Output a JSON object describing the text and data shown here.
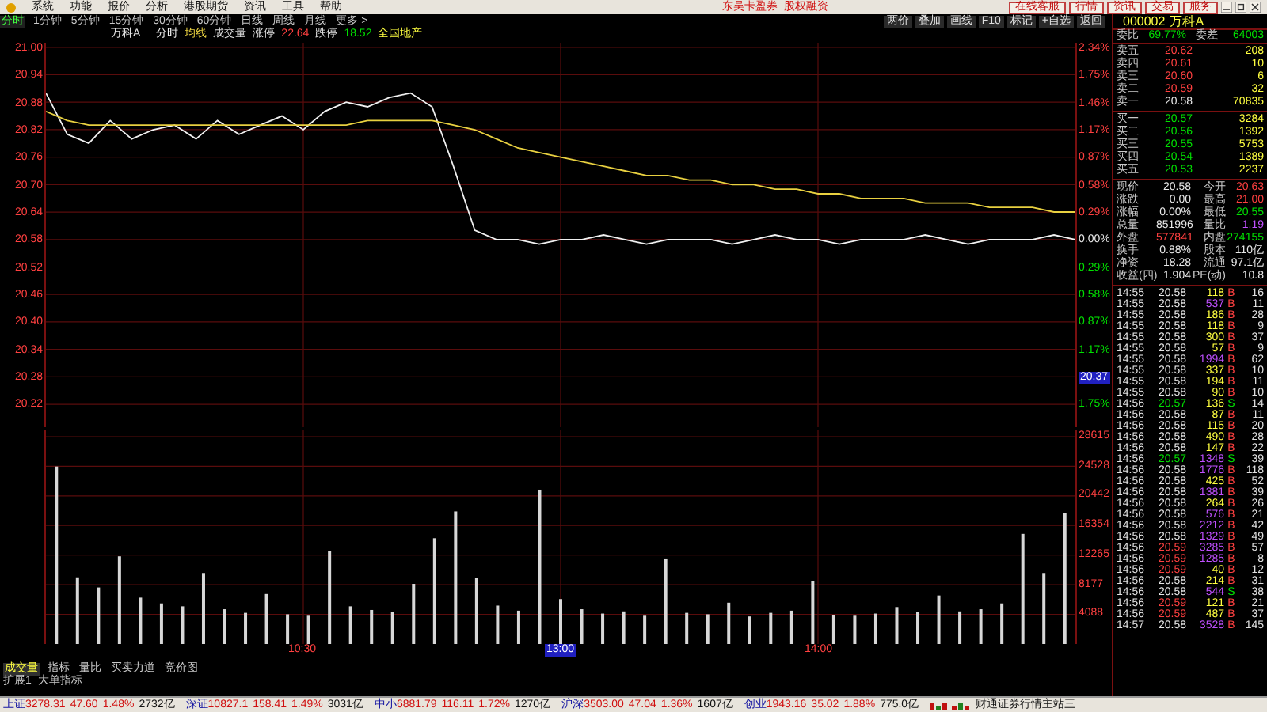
{
  "menu_bar": {
    "items": [
      "系统",
      "功能",
      "报价",
      "分析",
      "港股期货",
      "资讯",
      "工具",
      "帮助"
    ],
    "promo": [
      "东吴卡盈券",
      "股权融资"
    ],
    "buttons": [
      "在线客服",
      "行情",
      "资讯",
      "交易",
      "服务"
    ]
  },
  "period_tabs": [
    {
      "label": "分时",
      "selected": true
    },
    {
      "label": "1分钟",
      "selected": false
    },
    {
      "label": "5分钟",
      "selected": false
    },
    {
      "label": "15分钟",
      "selected": false
    },
    {
      "label": "30分钟",
      "selected": false
    },
    {
      "label": "60分钟",
      "selected": false
    },
    {
      "label": "日线",
      "selected": false
    },
    {
      "label": "周线",
      "selected": false
    },
    {
      "label": "月线",
      "selected": false
    },
    {
      "label": "更多 >",
      "selected": false
    }
  ],
  "toolbar": [
    "两价",
    "叠加",
    "画线",
    "F10",
    "标记",
    "+自选",
    "返回"
  ],
  "stock_info": {
    "name": "万科A",
    "limit_up_label": "涨停",
    "limit_up": "22.64",
    "limit_down_label": "跌停",
    "limit_down": "18.52",
    "sector": "全国地产"
  },
  "chart": {
    "price_chart": {
      "chart_data": {
        "type": "line",
        "categories": [
          null,
          null,
          null,
          null,
          null,
          null,
          null,
          null,
          null,
          null,
          null,
          null,
          null,
          null,
          null,
          null,
          null,
          null,
          null,
          null,
          null,
          null,
          null,
          null,
          null,
          null,
          null,
          null,
          null,
          null,
          null,
          null,
          null,
          null,
          null,
          null,
          null,
          null,
          null,
          null,
          null,
          null,
          null,
          null,
          null,
          null,
          null,
          null,
          null
        ],
        "ylim": [
          20.17,
          21.01
        ],
        "grid": true,
        "yticks": [
          {
            "value": 21.0,
            "label": "21.00"
          },
          {
            "value": 20.94,
            "label": "20.94"
          },
          {
            "value": 20.88,
            "label": "20.88"
          },
          {
            "value": 20.82,
            "label": "20.82"
          },
          {
            "value": 20.76,
            "label": "20.76"
          },
          {
            "value": 20.7,
            "label": "20.70"
          },
          {
            "value": 20.64,
            "label": "20.64"
          },
          {
            "value": 20.58,
            "label": "20.58"
          },
          {
            "value": 20.52,
            "label": "20.52"
          },
          {
            "value": 20.46,
            "label": "20.46"
          },
          {
            "value": 20.4,
            "label": "20.40"
          },
          {
            "value": 20.34,
            "label": "20.34"
          },
          {
            "value": 20.28,
            "label": "20.28"
          },
          {
            "value": 20.22,
            "label": "20.22"
          }
        ],
        "series": [
          {
            "name": "分时",
            "color": "#f0f0f0",
            "values": [
              20.9,
              20.81,
              20.79,
              20.84,
              20.8,
              20.82,
              20.83,
              20.8,
              20.84,
              20.81,
              20.83,
              20.85,
              20.82,
              20.86,
              20.88,
              20.87,
              20.89,
              20.9,
              20.87,
              20.74,
              20.6,
              20.58,
              20.58,
              20.57,
              20.58,
              20.58,
              20.59,
              20.58,
              20.57,
              20.58,
              20.58,
              20.58,
              20.57,
              20.58,
              20.59,
              20.58,
              20.58,
              20.57,
              20.58,
              20.58,
              20.58,
              20.59,
              20.58,
              20.57,
              20.58,
              20.58,
              20.58,
              20.59,
              20.58
            ]
          },
          {
            "name": "均线",
            "color": "#e8d040",
            "values": [
              20.86,
              20.84,
              20.83,
              20.83,
              20.83,
              20.83,
              20.83,
              20.83,
              20.83,
              20.83,
              20.83,
              20.83,
              20.83,
              20.83,
              20.83,
              20.84,
              20.84,
              20.84,
              20.84,
              20.83,
              20.82,
              20.8,
              20.78,
              20.77,
              20.76,
              20.75,
              20.74,
              20.73,
              20.72,
              20.72,
              20.71,
              20.71,
              20.7,
              20.7,
              20.69,
              20.69,
              20.68,
              20.68,
              20.67,
              20.67,
              20.67,
              20.66,
              20.66,
              20.66,
              20.65,
              20.65,
              20.65,
              20.64,
              20.64
            ]
          }
        ]
      }
    },
    "percent_labels": [
      {
        "text": "2.34%",
        "color": "#ff4040"
      },
      {
        "text": "1.75%",
        "color": "#ff4040"
      },
      {
        "text": "1.46%",
        "color": "#ff4040"
      },
      {
        "text": "1.17%",
        "color": "#ff4040"
      },
      {
        "text": "0.87%",
        "color": "#ff4040"
      },
      {
        "text": "0.58%",
        "color": "#ff4040"
      },
      {
        "text": "0.29%",
        "color": "#ff4040"
      },
      {
        "text": "0.00%",
        "color": "#e8e8e8"
      },
      {
        "text": "0.29%",
        "color": "#00e000"
      },
      {
        "text": "0.58%",
        "color": "#00e000"
      },
      {
        "text": "0.87%",
        "color": "#00e000"
      },
      {
        "text": "1.17%",
        "color": "#00e000"
      },
      {
        "text": "20.37",
        "color": "#2020c0",
        "kind": "cursor"
      },
      {
        "text": "1.75%",
        "color": "#00e000"
      }
    ],
    "volume_chart": {
      "chart_data": {
        "type": "bar",
        "categories": [
          null,
          null,
          null,
          null,
          null,
          null,
          null,
          null,
          null,
          null,
          null,
          null,
          null,
          null,
          null,
          null,
          null,
          null,
          null,
          null,
          null,
          null,
          null,
          null,
          null,
          null,
          null,
          null,
          null,
          null,
          null,
          null,
          null,
          null,
          null,
          null,
          null,
          null,
          null,
          null,
          null,
          null,
          null,
          null,
          null,
          null,
          null,
          null,
          null
        ],
        "ylim": [
          0,
          29489
        ],
        "grid": true,
        "yticks": [
          {
            "value": 28615,
            "label": "28615"
          },
          {
            "value": 24528,
            "label": "24528"
          },
          {
            "value": 20442,
            "label": "20442"
          },
          {
            "value": 16354,
            "label": "16354"
          },
          {
            "value": 12265,
            "label": "12265"
          },
          {
            "value": 8177,
            "label": "8177"
          },
          {
            "value": 4088,
            "label": "4088"
          }
        ],
        "series": [
          {
            "name": "成交量",
            "color": "#d8d8d8",
            "values": [
              24500,
              9200,
              7800,
              12100,
              6400,
              5600,
              5200,
              9800,
              4800,
              4300,
              6900,
              4100,
              3900,
              12800,
              5200,
              4700,
              4400,
              8300,
              14600,
              18300,
              9100,
              5300,
              4600,
              21300,
              6200,
              4800,
              4200,
              4500,
              3900,
              11800,
              4300,
              4100,
              5700,
              3800,
              4300,
              4600,
              8700,
              4000,
              3900,
              4200,
              5100,
              4400,
              6700,
              4500,
              4800,
              5600,
              15200,
              9800,
              18100
            ]
          }
        ]
      }
    },
    "time_labels": [
      {
        "text": "10:30",
        "cursor": false
      },
      {
        "text": "13:00",
        "cursor": true
      },
      {
        "text": "14:00",
        "cursor": false
      }
    ]
  },
  "indicator_tabs": [
    {
      "label": "成交量",
      "selected": true
    },
    {
      "label": "指标",
      "selected": false
    },
    {
      "label": "量比",
      "selected": false
    },
    {
      "label": "买卖力道",
      "selected": false
    },
    {
      "label": "竞价图",
      "selected": false
    }
  ],
  "extension_tabs": [
    "扩展1",
    "大单指标"
  ],
  "quote": {
    "code": "000002",
    "name": "万科A",
    "ratio_label": "委比",
    "ratio": "69.77%",
    "diff_label": "委差",
    "diff": "64003",
    "asks": [
      {
        "label": "卖五",
        "price": "20.62",
        "volume": "208",
        "color": "#ff4040"
      },
      {
        "label": "卖四",
        "price": "20.61",
        "volume": "10",
        "color": "#ff4040"
      },
      {
        "label": "卖三",
        "price": "20.60",
        "volume": "6",
        "color": "#ff4040"
      },
      {
        "label": "卖二",
        "price": "20.59",
        "volume": "32",
        "color": "#ff4040"
      },
      {
        "label": "卖一",
        "price": "20.58",
        "volume": "70835",
        "color": "#e8e8e8"
      }
    ],
    "bids": [
      {
        "label": "买一",
        "price": "20.57",
        "volume": "3284",
        "color": "#00e000"
      },
      {
        "label": "买二",
        "price": "20.56",
        "volume": "1392",
        "color": "#00e000"
      },
      {
        "label": "买三",
        "price": "20.55",
        "volume": "5753",
        "color": "#00e000"
      },
      {
        "label": "买四",
        "price": "20.54",
        "volume": "1389",
        "color": "#00e000"
      },
      {
        "label": "买五",
        "price": "20.53",
        "volume": "2237",
        "color": "#00e000"
      }
    ],
    "stats": [
      {
        "cells": [
          {
            "label": "现价",
            "value": "20.58",
            "color": "#e8e8e8"
          },
          {
            "label": "今开",
            "value": "20.63",
            "color": "#ff4040"
          }
        ]
      },
      {
        "cells": [
          {
            "label": "涨跌",
            "value": "0.00",
            "color": "#e8e8e8"
          },
          {
            "label": "最高",
            "value": "21.00",
            "color": "#ff4040"
          }
        ]
      },
      {
        "cells": [
          {
            "label": "涨幅",
            "value": "0.00%",
            "color": "#e8e8e8"
          },
          {
            "label": "最低",
            "value": "20.55",
            "color": "#00e000"
          }
        ]
      },
      {
        "cells": [
          {
            "label": "总量",
            "value": "851996",
            "color": "#e8e8e8"
          },
          {
            "label": "量比",
            "value": "1.19",
            "color": "#c050ff"
          }
        ]
      },
      {
        "cells": [
          {
            "label": "外盘",
            "value": "577841",
            "color": "#ff4040"
          },
          {
            "label": "内盘",
            "value": "274155",
            "color": "#00e000"
          }
        ]
      },
      {
        "cells": [
          {
            "label": "换手",
            "value": "0.88%",
            "color": "#e8e8e8"
          },
          {
            "label": "股本",
            "value": "110亿",
            "color": "#e8e8e8"
          }
        ]
      },
      {
        "cells": [
          {
            "label": "净资",
            "value": "18.28",
            "color": "#e8e8e8"
          },
          {
            "label": "流通",
            "value": "97.1亿",
            "color": "#e8e8e8"
          }
        ]
      },
      {
        "cells": [
          {
            "label": "收益(四)",
            "value": "1.904",
            "color": "#e8e8e8"
          },
          {
            "label": "PE(动)",
            "value": "10.8",
            "color": "#e8e8e8"
          }
        ]
      }
    ],
    "ticks": [
      {
        "time": "14:55",
        "price": "20.58",
        "color": "#e8e8e8",
        "volume": "118",
        "large": false,
        "side": "B",
        "count": "16"
      },
      {
        "time": "14:55",
        "price": "20.58",
        "color": "#e8e8e8",
        "volume": "537",
        "large": true,
        "side": "B",
        "count": "11"
      },
      {
        "time": "14:55",
        "price": "20.58",
        "color": "#e8e8e8",
        "volume": "186",
        "large": false,
        "side": "B",
        "count": "28"
      },
      {
        "time": "14:55",
        "price": "20.58",
        "color": "#e8e8e8",
        "volume": "118",
        "large": false,
        "side": "B",
        "count": "9"
      },
      {
        "time": "14:55",
        "price": "20.58",
        "color": "#e8e8e8",
        "volume": "300",
        "large": false,
        "side": "B",
        "count": "37"
      },
      {
        "time": "14:55",
        "price": "20.58",
        "color": "#e8e8e8",
        "volume": "57",
        "large": false,
        "side": "B",
        "count": "9"
      },
      {
        "time": "14:55",
        "price": "20.58",
        "color": "#e8e8e8",
        "volume": "1994",
        "large": true,
        "side": "B",
        "count": "62"
      },
      {
        "time": "14:55",
        "price": "20.58",
        "color": "#e8e8e8",
        "volume": "337",
        "large": false,
        "side": "B",
        "count": "10"
      },
      {
        "time": "14:55",
        "price": "20.58",
        "color": "#e8e8e8",
        "volume": "194",
        "large": false,
        "side": "B",
        "count": "11"
      },
      {
        "time": "14:55",
        "price": "20.58",
        "color": "#e8e8e8",
        "volume": "90",
        "large": false,
        "side": "B",
        "count": "10"
      },
      {
        "time": "14:56",
        "price": "20.57",
        "color": "#00e000",
        "volume": "136",
        "large": false,
        "side": "S",
        "count": "14"
      },
      {
        "time": "14:56",
        "price": "20.58",
        "color": "#e8e8e8",
        "volume": "87",
        "large": false,
        "side": "B",
        "count": "11"
      },
      {
        "time": "14:56",
        "price": "20.58",
        "color": "#e8e8e8",
        "volume": "115",
        "large": false,
        "side": "B",
        "count": "20"
      },
      {
        "time": "14:56",
        "price": "20.58",
        "color": "#e8e8e8",
        "volume": "490",
        "large": false,
        "side": "B",
        "count": "28"
      },
      {
        "time": "14:56",
        "price": "20.58",
        "color": "#e8e8e8",
        "volume": "147",
        "large": false,
        "side": "B",
        "count": "22"
      },
      {
        "time": "14:56",
        "price": "20.57",
        "color": "#00e000",
        "volume": "1348",
        "large": true,
        "side": "S",
        "count": "39"
      },
      {
        "time": "14:56",
        "price": "20.58",
        "color": "#e8e8e8",
        "volume": "1776",
        "large": true,
        "side": "B",
        "count": "118"
      },
      {
        "time": "14:56",
        "price": "20.58",
        "color": "#e8e8e8",
        "volume": "425",
        "large": false,
        "side": "B",
        "count": "52"
      },
      {
        "time": "14:56",
        "price": "20.58",
        "color": "#e8e8e8",
        "volume": "1381",
        "large": true,
        "side": "B",
        "count": "39"
      },
      {
        "time": "14:56",
        "price": "20.58",
        "color": "#e8e8e8",
        "volume": "264",
        "large": false,
        "side": "B",
        "count": "26"
      },
      {
        "time": "14:56",
        "price": "20.58",
        "color": "#e8e8e8",
        "volume": "576",
        "large": true,
        "side": "B",
        "count": "21"
      },
      {
        "time": "14:56",
        "price": "20.58",
        "color": "#e8e8e8",
        "volume": "2212",
        "large": true,
        "side": "B",
        "count": "42"
      },
      {
        "time": "14:56",
        "price": "20.58",
        "color": "#e8e8e8",
        "volume": "1329",
        "large": true,
        "side": "B",
        "count": "49"
      },
      {
        "time": "14:56",
        "price": "20.59",
        "color": "#ff4040",
        "volume": "3285",
        "large": true,
        "side": "B",
        "count": "57"
      },
      {
        "time": "14:56",
        "price": "20.59",
        "color": "#ff4040",
        "volume": "1285",
        "large": true,
        "side": "B",
        "count": "8"
      },
      {
        "time": "14:56",
        "price": "20.59",
        "color": "#ff4040",
        "volume": "40",
        "large": false,
        "side": "B",
        "count": "12"
      },
      {
        "time": "14:56",
        "price": "20.58",
        "color": "#e8e8e8",
        "volume": "214",
        "large": false,
        "side": "B",
        "count": "31"
      },
      {
        "time": "14:56",
        "price": "20.58",
        "color": "#e8e8e8",
        "volume": "544",
        "large": true,
        "side": "S",
        "count": "38"
      },
      {
        "time": "14:56",
        "price": "20.59",
        "color": "#ff4040",
        "volume": "121",
        "large": false,
        "side": "B",
        "count": "21"
      },
      {
        "time": "14:56",
        "price": "20.59",
        "color": "#ff4040",
        "volume": "487",
        "large": false,
        "side": "B",
        "count": "37"
      },
      {
        "time": "14:57",
        "price": "20.58",
        "color": "#e8e8e8",
        "volume": "3528",
        "large": true,
        "side": "B",
        "count": "145"
      }
    ]
  },
  "status_bar": {
    "indices": [
      {
        "name": "上证",
        "value": "3278.31",
        "change": "47.60",
        "pct": "1.48%",
        "amount": "2732亿"
      },
      {
        "name": "深证",
        "value": "10827.1",
        "change": "158.41",
        "pct": "1.49%",
        "amount": "3031亿"
      },
      {
        "name": "中小",
        "value": "6881.79",
        "change": "116.11",
        "pct": "1.72%",
        "amount": "1270亿"
      },
      {
        "name": "沪深",
        "value": "3503.00",
        "change": "47.04",
        "pct": "1.36%",
        "amount": "1607亿"
      },
      {
        "name": "创业",
        "value": "1943.16",
        "change": "35.02",
        "pct": "1.88%",
        "amount": "775.0亿"
      }
    ],
    "broker": "财通证券行情主站三"
  }
}
